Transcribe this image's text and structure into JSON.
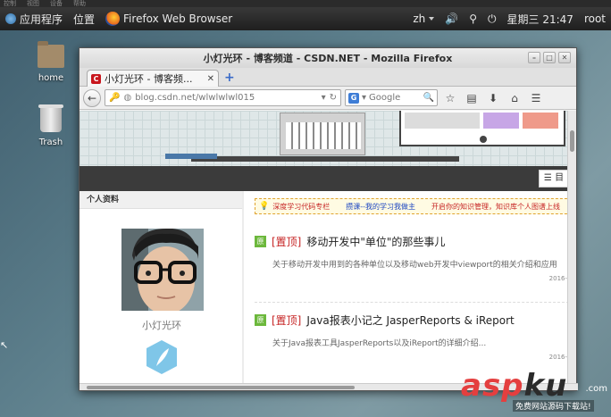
{
  "system_menu": {
    "items": [
      "控制",
      "视图",
      "设备",
      "帮助"
    ]
  },
  "top_panel": {
    "apps_label": "应用程序",
    "places_label": "位置",
    "active_window_label": "Firefox Web Browser",
    "input_method": "zh",
    "clock": "星期三 21:47",
    "user": "root"
  },
  "desktop": {
    "icons": [
      {
        "label": "home"
      },
      {
        "label": "Trash"
      }
    ]
  },
  "window": {
    "title": "小灯光环 - 博客频道 - CSDN.NET - Mozilla Firefox",
    "tab_title": "小灯光环 - 博客频...",
    "tab_favicon": "C",
    "url": "blog.csdn.net/wlwlwlwl015",
    "search_engine_letter": "G",
    "search_placeholder": "Google",
    "menu_button_label": "☰ 目"
  },
  "page": {
    "sidebar_header": "个人资料",
    "nickname": "小灯光环",
    "notice": {
      "item1": "深度学习代码专栏",
      "item2": "攒课--我的学习我做主",
      "item3": "开启你的知识管理，知识库个人图谱上线"
    },
    "posts": [
      {
        "badge": "原",
        "pinned": "[置顶]",
        "title": "移动开发中\"单位\"的那些事儿",
        "summary": "关于移动开发中用到的各种单位以及移动web开发中viewport的相关介绍和应用",
        "date": "2016-"
      },
      {
        "badge": "原",
        "pinned": "[置顶]",
        "title": "Java报表小记之 JasperReports & iReport",
        "summary": "关于Java报表工具JasperReports以及iReport的详细介绍...",
        "date": "2016-"
      }
    ]
  },
  "watermark": {
    "brand_a": "asp",
    "brand_b": "ku",
    "suffix": ".com",
    "tagline": "免费网站源码下载站!"
  },
  "colors": {
    "accent_red": "#c62424",
    "link_blue": "#1d47c2",
    "badge_green": "#6cb83c"
  }
}
